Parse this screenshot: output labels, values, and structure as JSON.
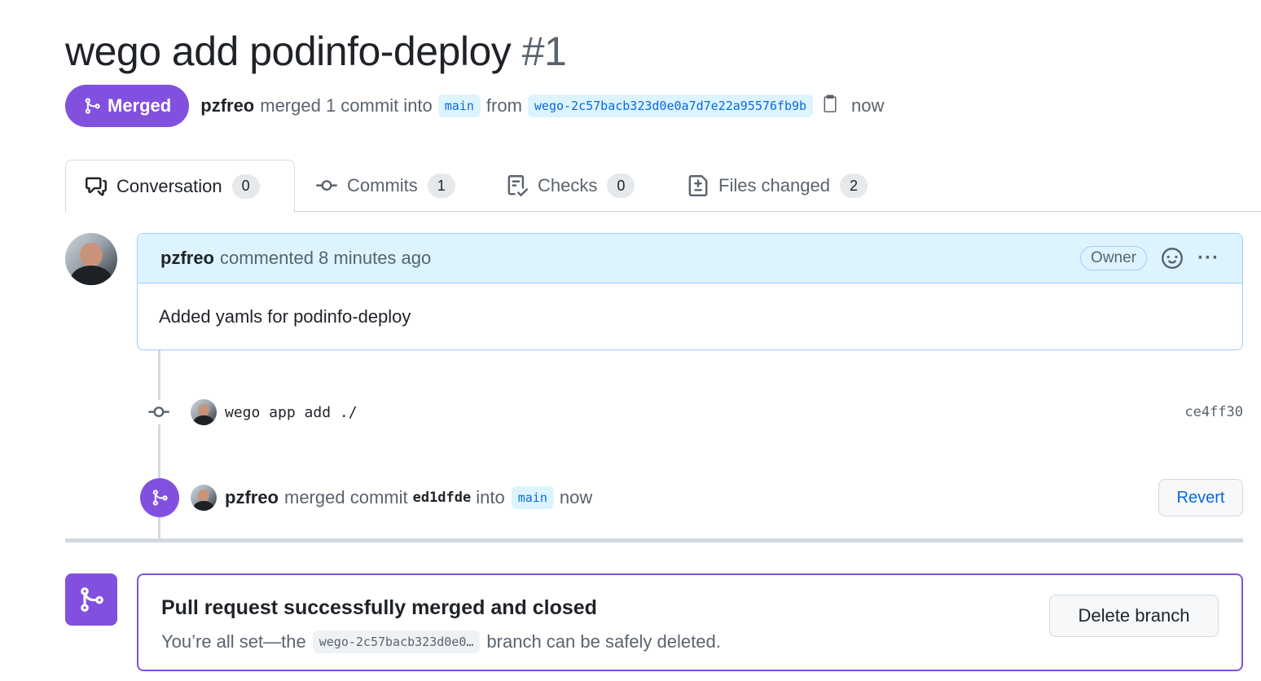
{
  "pr": {
    "title": "wego add podinfo-deploy",
    "number": "#1",
    "state": "Merged",
    "author": "pzfreo",
    "merged_text": "merged 1 commit into",
    "base_branch": "main",
    "from_text": "from",
    "head_branch": "wego-2c57bacb323d0e0a7d7e22a95576fb9b",
    "time": "now"
  },
  "tabs": [
    {
      "label": "Conversation",
      "count": "0",
      "icon": "comment-discussion-icon"
    },
    {
      "label": "Commits",
      "count": "1",
      "icon": "git-commit-icon"
    },
    {
      "label": "Checks",
      "count": "0",
      "icon": "checklist-icon"
    },
    {
      "label": "Files changed",
      "count": "2",
      "icon": "file-diff-icon"
    }
  ],
  "comment": {
    "author": "pzfreo",
    "meta": "commented 8 minutes ago",
    "role": "Owner",
    "body": "Added yamls for podinfo-deploy"
  },
  "commit": {
    "message": "wego app add ./",
    "sha": "ce4ff30"
  },
  "merge_event": {
    "author": "pzfreo",
    "text1": "merged commit",
    "sha": "ed1dfde",
    "text2": "into",
    "branch": "main",
    "time": "now",
    "revert_label": "Revert"
  },
  "merged_box": {
    "heading": "Pull request successfully merged and closed",
    "sub_prefix": "You’re all set—the",
    "branch": "wego-2c57bacb323d0e0…",
    "sub_suffix": "branch can be safely deleted.",
    "delete_label": "Delete branch"
  },
  "colors": {
    "merged": "#8250df",
    "link": "#0969da",
    "branch_bg": "#ddf4ff"
  }
}
